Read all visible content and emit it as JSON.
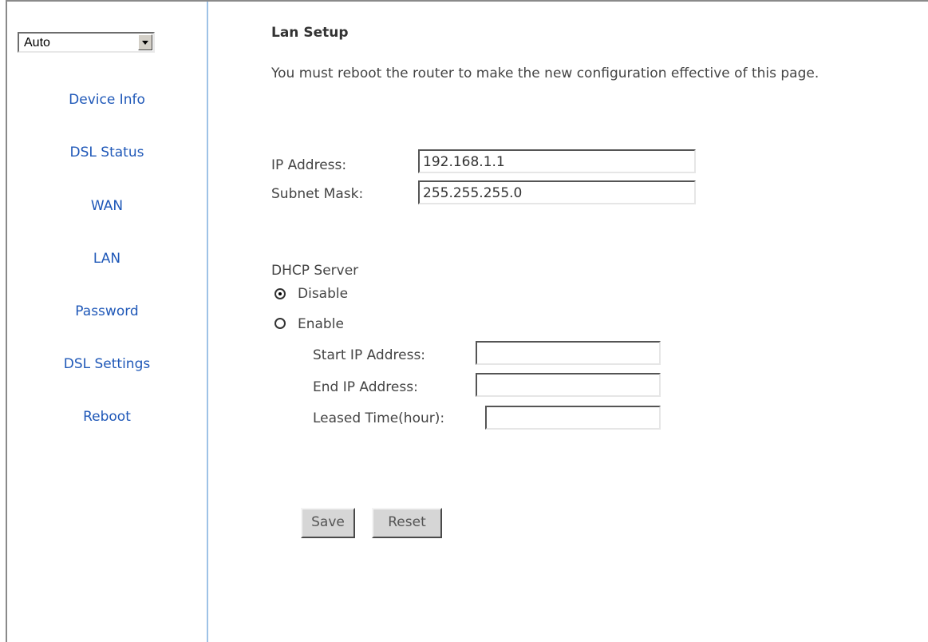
{
  "sidebar": {
    "language": {
      "selected": "Auto"
    },
    "items": [
      {
        "label": "Device Info"
      },
      {
        "label": "DSL Status"
      },
      {
        "label": "WAN"
      },
      {
        "label": "LAN"
      },
      {
        "label": "Password"
      },
      {
        "label": "DSL Settings"
      },
      {
        "label": "Reboot"
      }
    ]
  },
  "main": {
    "title": "Lan Setup",
    "note": "You must reboot the router to make the new configuration effective of this page.",
    "ip_address": {
      "label": "IP Address:",
      "value": "192.168.1.1"
    },
    "subnet_mask": {
      "label": "Subnet Mask:",
      "value": "255.255.255.0"
    },
    "dhcp": {
      "heading": "DHCP Server",
      "disable_label": "Disable",
      "enable_label": "Enable",
      "selected": "Disable",
      "start_ip": {
        "label": "Start IP Address:",
        "value": ""
      },
      "end_ip": {
        "label": "End IP Address:",
        "value": ""
      },
      "leased_time": {
        "label": "Leased Time(hour):",
        "value": ""
      }
    },
    "buttons": {
      "save": "Save",
      "reset": "Reset"
    }
  }
}
